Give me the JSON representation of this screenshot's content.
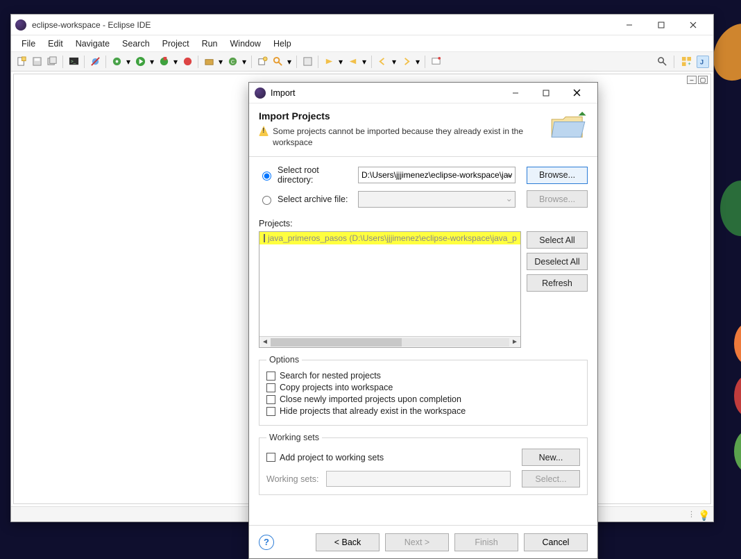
{
  "eclipse": {
    "title": "eclipse-workspace - Eclipse IDE",
    "menus": [
      "File",
      "Edit",
      "Navigate",
      "Search",
      "Project",
      "Run",
      "Window",
      "Help"
    ]
  },
  "import_dialog": {
    "title": "Import",
    "header_title": "Import Projects",
    "header_msg": "Some projects cannot be imported because they already exist in the workspace",
    "root_dir_label": "Select root directory:",
    "root_dir_value": "D:\\Users\\jjjimenez\\eclipse-workspace\\java_p",
    "archive_label": "Select archive file:",
    "browse_label": "Browse...",
    "projects_label": "Projects:",
    "project_item": "java_primeros_pasos (D:\\Users\\jjjimenez\\eclipse-workspace\\java_p",
    "select_all": "Select All",
    "deselect_all": "Deselect All",
    "refresh": "Refresh",
    "options_legend": "Options",
    "opt_nested": "Search for nested projects",
    "opt_copy": "Copy projects into workspace",
    "opt_close": "Close newly imported projects upon completion",
    "opt_hide": "Hide projects that already exist in the workspace",
    "ws_legend": "Working sets",
    "ws_add": "Add project to working sets",
    "ws_new": "New...",
    "ws_label": "Working sets:",
    "ws_select": "Select...",
    "back": "< Back",
    "next": "Next >",
    "finish": "Finish",
    "cancel": "Cancel"
  }
}
